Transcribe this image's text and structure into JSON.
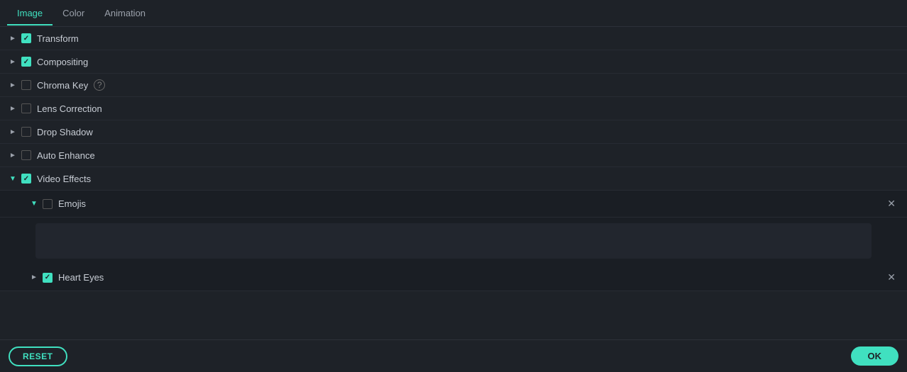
{
  "tabs": [
    {
      "id": "image",
      "label": "Image",
      "active": true
    },
    {
      "id": "color",
      "label": "Color",
      "active": false
    },
    {
      "id": "animation",
      "label": "Animation",
      "active": false
    }
  ],
  "sections": [
    {
      "id": "transform",
      "label": "Transform",
      "checked": true,
      "expanded": false,
      "indent": 0
    },
    {
      "id": "compositing",
      "label": "Compositing",
      "checked": true,
      "expanded": false,
      "indent": 0
    },
    {
      "id": "chroma-key",
      "label": "Chroma Key",
      "checked": false,
      "expanded": false,
      "indent": 0,
      "hasHelp": true
    },
    {
      "id": "lens-correction",
      "label": "Lens Correction",
      "checked": false,
      "expanded": false,
      "indent": 0
    },
    {
      "id": "drop-shadow",
      "label": "Drop Shadow",
      "checked": false,
      "expanded": false,
      "indent": 0
    },
    {
      "id": "auto-enhance",
      "label": "Auto Enhance",
      "checked": false,
      "expanded": false,
      "indent": 0
    },
    {
      "id": "video-effects",
      "label": "Video Effects",
      "checked": true,
      "expanded": true,
      "indent": 0
    }
  ],
  "videoEffectsChildren": [
    {
      "id": "emojis",
      "label": "Emojis",
      "checked": false,
      "expanded": true,
      "showClose": true
    },
    {
      "id": "heart-eyes",
      "label": "Heart Eyes",
      "checked": true,
      "expanded": false,
      "showClose": true
    }
  ],
  "buttons": {
    "reset": "RESET",
    "ok": "OK"
  },
  "colors": {
    "accent": "#40e0c0",
    "bg": "#1e2228",
    "border": "#2d3139"
  }
}
